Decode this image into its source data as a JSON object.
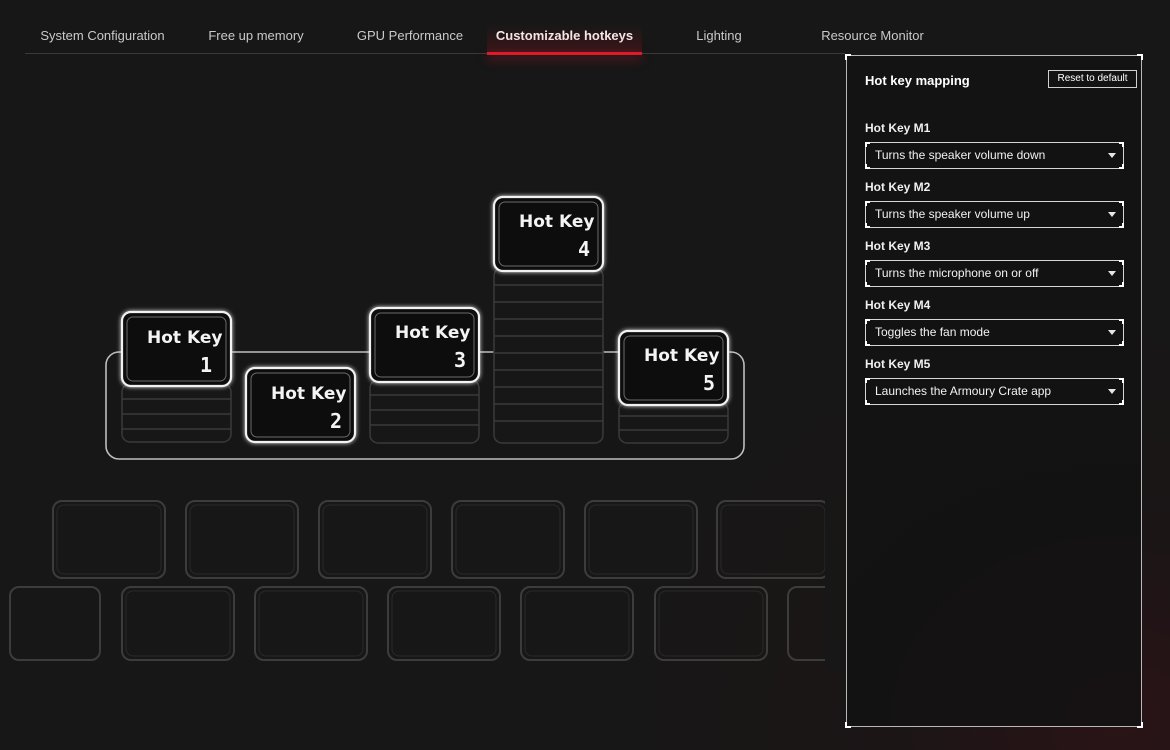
{
  "tabs": [
    {
      "label": "System Configuration"
    },
    {
      "label": "Free up memory"
    },
    {
      "label": "GPU Performance"
    },
    {
      "label": "Customizable hotkeys",
      "active": true
    },
    {
      "label": "Lighting"
    },
    {
      "label": "Resource Monitor"
    }
  ],
  "keyboard": {
    "keys": [
      {
        "title": "Hot Key",
        "number": "1"
      },
      {
        "title": "Hot Key",
        "number": "2"
      },
      {
        "title": "Hot Key",
        "number": "3"
      },
      {
        "title": "Hot Key",
        "number": "4"
      },
      {
        "title": "Hot Key",
        "number": "5"
      }
    ]
  },
  "panel": {
    "title": "Hot key mapping",
    "reset_label": "Reset to default",
    "mappings": [
      {
        "label": "Hot Key M1",
        "value": "Turns the speaker volume down"
      },
      {
        "label": "Hot Key M2",
        "value": "Turns the speaker volume up"
      },
      {
        "label": "Hot Key M3",
        "value": "Turns the microphone on or off"
      },
      {
        "label": "Hot Key M4",
        "value": "Toggles the fan mode"
      },
      {
        "label": "Hot Key M5",
        "value": "Launches the Armoury Crate app"
      }
    ]
  },
  "colors": {
    "accent": "#e01a2a",
    "background": "#171717",
    "panel_border": "#b8b8b8"
  }
}
